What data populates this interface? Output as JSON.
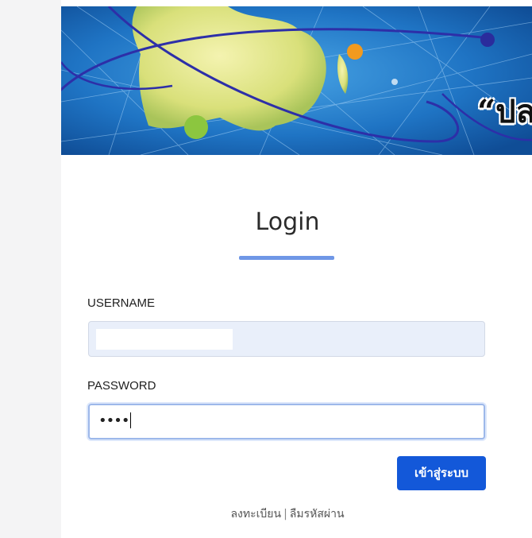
{
  "banner": {
    "text": "“ปล",
    "image_name": "globe-network-banner"
  },
  "login": {
    "title": "Login",
    "username_label": "USERNAME",
    "username_value": "",
    "password_label": "PASSWORD",
    "password_value": "••••",
    "submit_label": "เข้าสู่ระบบ"
  },
  "footer": {
    "register_link": "ลงทะเบียน",
    "separator": "|",
    "forgot_link": "ลืมรหัสผ่าน"
  },
  "colors": {
    "accent": "#1358d9",
    "underline": "#6f97e6",
    "autofill_bg": "#e9effa",
    "focus_border": "#9db8ea"
  }
}
